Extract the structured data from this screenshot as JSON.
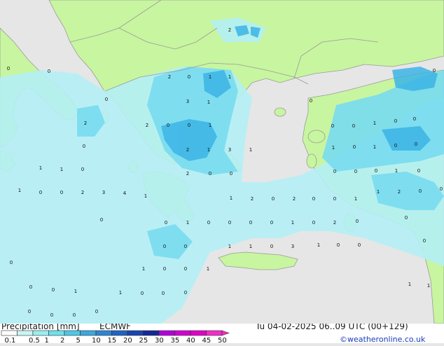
{
  "footer": {
    "title": "Precipitation [mm]",
    "model": "ECMWF",
    "datetime": "Tu 04-02-2025 06..09 UTC (00+129)",
    "credit": "©weatheronline.co.uk"
  },
  "legend": {
    "ticks": [
      "0.1",
      "0.5",
      "1",
      "2",
      "5",
      "10",
      "15",
      "20",
      "25",
      "30",
      "35",
      "40",
      "45",
      "50"
    ],
    "colors": [
      "#ffffff",
      "#c8f5f5",
      "#9beef0",
      "#6fe0eb",
      "#4cc8e6",
      "#3ca8de",
      "#2d86d2",
      "#1f64c4",
      "#1845b0",
      "#12289a",
      "#b400dc",
      "#d200d2",
      "#e100c8",
      "#f02dc8"
    ]
  },
  "map_colors": {
    "sea": "#e6e6e6",
    "land": "#c8f5a0",
    "precip_light": "#b4f0f5",
    "precip_medium": "#78dcf0",
    "precip_heavy": "#3cb4e6",
    "border": "#9a9a9a"
  },
  "values": [
    {
      "t": "0"
    },
    {
      "t": "0"
    },
    {
      "t": "2"
    },
    {
      "t": "0"
    },
    {
      "t": "0"
    },
    {
      "t": "2"
    },
    {
      "t": "0"
    },
    {
      "t": "1"
    },
    {
      "t": "1"
    },
    {
      "t": "2"
    },
    {
      "t": "3"
    },
    {
      "t": "1"
    },
    {
      "t": "2"
    },
    {
      "t": "0"
    },
    {
      "t": "0"
    },
    {
      "t": "1"
    },
    {
      "t": "1"
    },
    {
      "t": "2"
    },
    {
      "t": "3"
    },
    {
      "t": "1"
    },
    {
      "t": "2"
    },
    {
      "t": "0"
    },
    {
      "t": "0"
    },
    {
      "t": "1"
    },
    {
      "t": "1"
    },
    {
      "t": "0"
    },
    {
      "t": "1"
    },
    {
      "t": "0"
    },
    {
      "t": "0"
    },
    {
      "t": "2"
    },
    {
      "t": "3"
    },
    {
      "t": "4"
    },
    {
      "t": "1"
    },
    {
      "t": "1"
    },
    {
      "t": "2"
    },
    {
      "t": "0"
    },
    {
      "t": "2"
    },
    {
      "t": "0"
    },
    {
      "t": "0"
    },
    {
      "t": "1"
    },
    {
      "t": "1"
    },
    {
      "t": "2"
    },
    {
      "t": "0"
    },
    {
      "t": "0"
    },
    {
      "t": "0"
    },
    {
      "t": "0"
    },
    {
      "t": "1"
    },
    {
      "t": "0"
    },
    {
      "t": "0"
    },
    {
      "t": "0"
    },
    {
      "t": "0"
    },
    {
      "t": "1"
    },
    {
      "t": "0"
    },
    {
      "t": "2"
    },
    {
      "t": "0"
    },
    {
      "t": "0"
    },
    {
      "t": "0"
    },
    {
      "t": "0"
    },
    {
      "t": "0"
    },
    {
      "t": "1"
    },
    {
      "t": "1"
    },
    {
      "t": "0"
    },
    {
      "t": "3"
    },
    {
      "t": "1"
    },
    {
      "t": "0"
    },
    {
      "t": "0"
    },
    {
      "t": "0"
    },
    {
      "t": "1"
    },
    {
      "t": "0"
    },
    {
      "t": "0"
    },
    {
      "t": "1"
    },
    {
      "t": "0"
    },
    {
      "t": "0"
    },
    {
      "t": "1"
    },
    {
      "t": "1"
    },
    {
      "t": "0"
    },
    {
      "t": "0"
    },
    {
      "t": "0"
    },
    {
      "t": "1"
    },
    {
      "t": "1"
    },
    {
      "t": "0"
    },
    {
      "t": "0"
    },
    {
      "t": "0"
    },
    {
      "t": "0"
    },
    {
      "t": "0"
    },
    {
      "t": "0"
    },
    {
      "t": "0"
    },
    {
      "t": "1"
    },
    {
      "t": "0"
    },
    {
      "t": "0"
    },
    {
      "t": "1"
    },
    {
      "t": "0"
    },
    {
      "t": "1"
    },
    {
      "t": "0"
    },
    {
      "t": "0"
    },
    {
      "t": "0"
    },
    {
      "t": "0"
    },
    {
      "t": "0"
    },
    {
      "t": "1"
    },
    {
      "t": "0"
    },
    {
      "t": "0"
    },
    {
      "t": "0"
    },
    {
      "t": "0"
    }
  ]
}
